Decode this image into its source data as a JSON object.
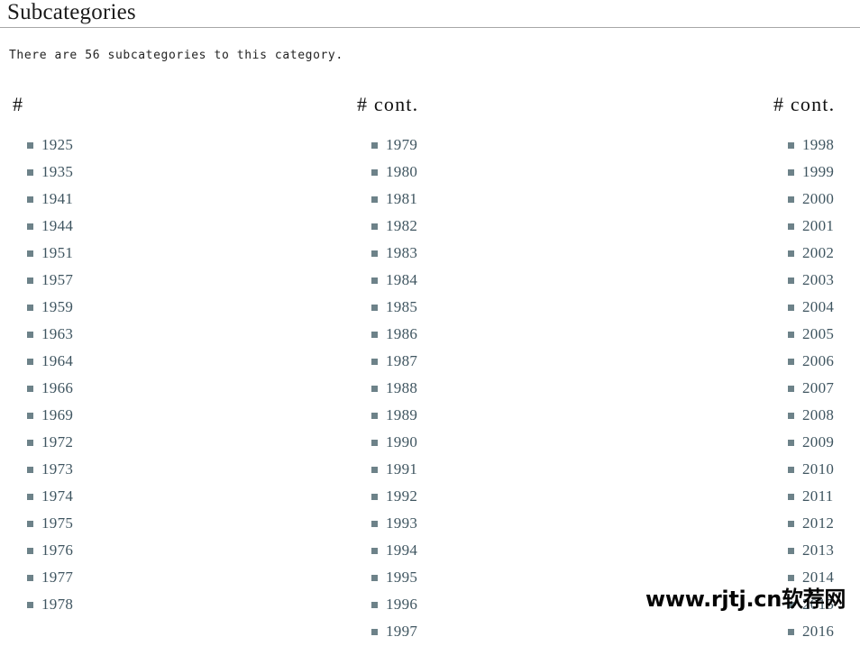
{
  "heading": {
    "title": "Subcategories"
  },
  "intro": {
    "text": "There are 56 subcategories to this category."
  },
  "columns": [
    {
      "header": "#",
      "items": [
        "1925",
        "1935",
        "1941",
        "1944",
        "1951",
        "1957",
        "1959",
        "1963",
        "1964",
        "1966",
        "1969",
        "1972",
        "1973",
        "1974",
        "1975",
        "1976",
        "1977",
        "1978"
      ]
    },
    {
      "header": "# cont.",
      "items": [
        "1979",
        "1980",
        "1981",
        "1982",
        "1983",
        "1984",
        "1985",
        "1986",
        "1987",
        "1988",
        "1989",
        "1990",
        "1991",
        "1992",
        "1993",
        "1994",
        "1995",
        "1996",
        "1997"
      ]
    },
    {
      "header": "# cont.",
      "items": [
        "1998",
        "1999",
        "2000",
        "2001",
        "2002",
        "2003",
        "2004",
        "2005",
        "2006",
        "2007",
        "2008",
        "2009",
        "2010",
        "2011",
        "2012",
        "2013",
        "2014",
        "2015",
        "2016"
      ]
    }
  ],
  "watermark": {
    "text": "www.rjtj.cn软荐网"
  },
  "colors": {
    "bullet": "#6d8289",
    "link": "#3f5560",
    "rule": "#a7a7a7",
    "text": "#232323"
  }
}
